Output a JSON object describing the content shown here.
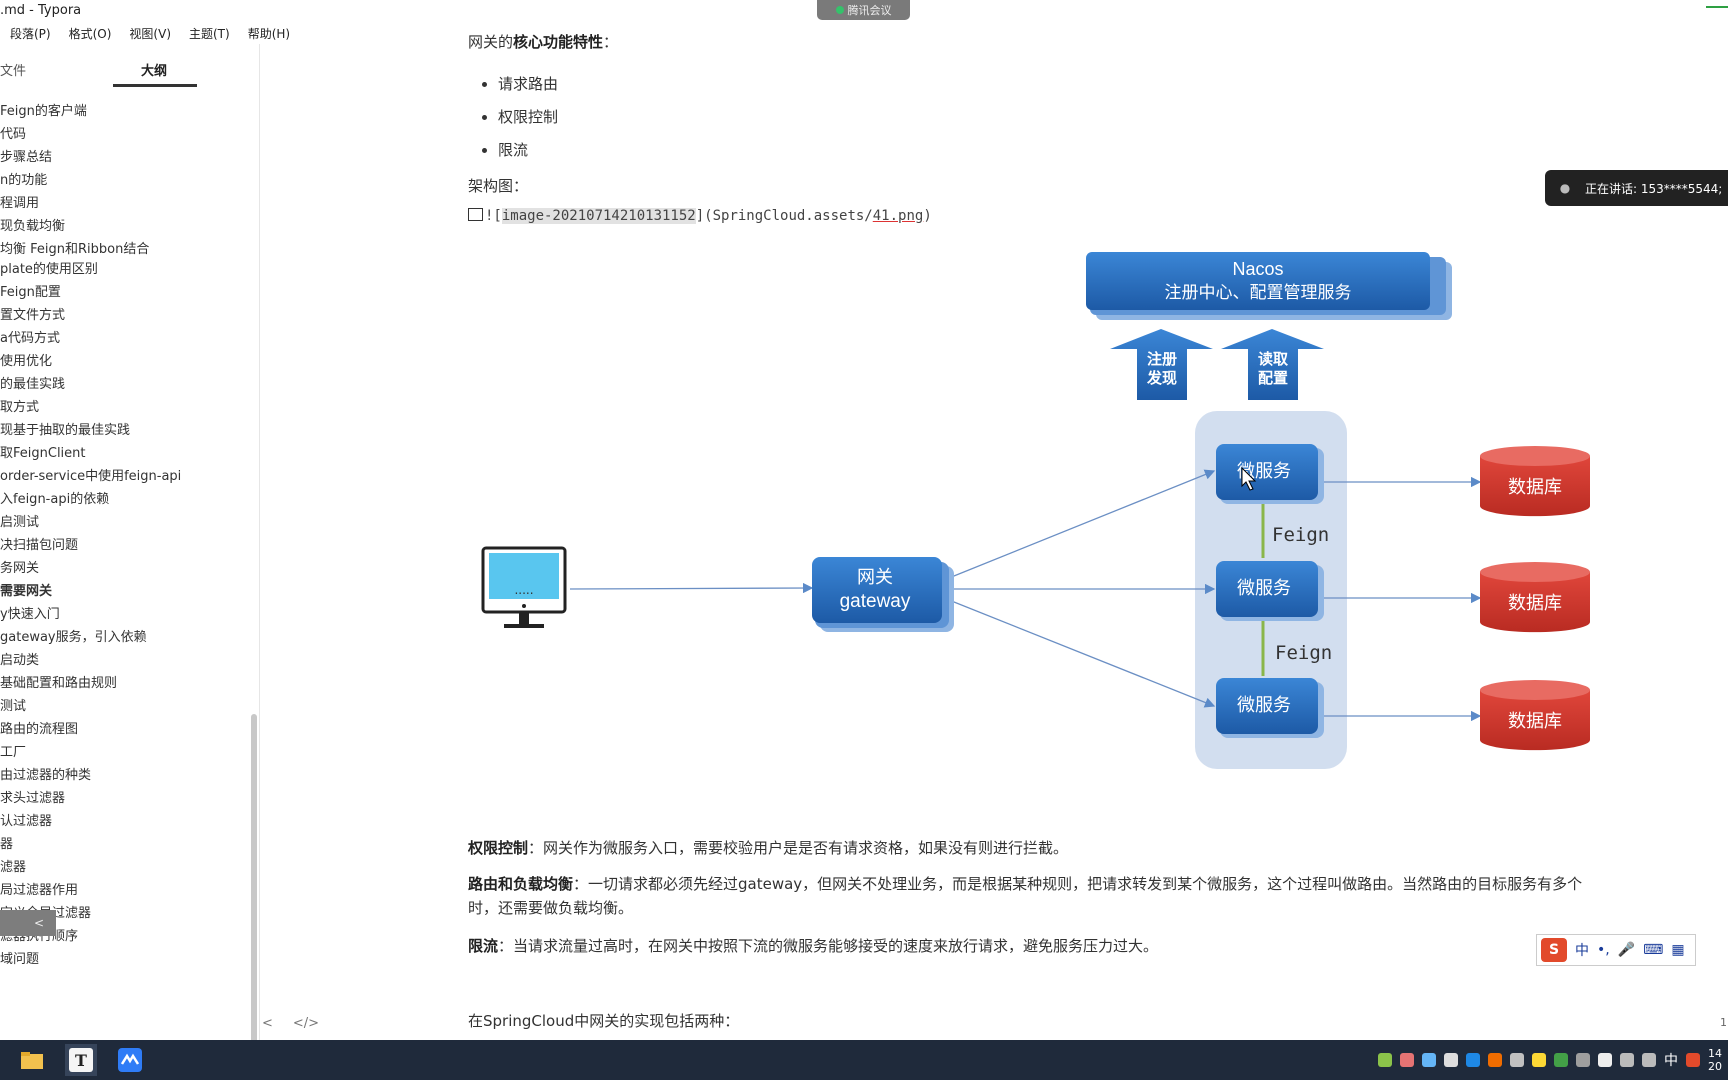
{
  "window": {
    "title": ".md - Typora"
  },
  "meeting": {
    "label": "腾讯会议"
  },
  "menu": [
    "段落(P)",
    "格式(O)",
    "视图(V)",
    "主题(T)",
    "帮助(H)"
  ],
  "sidebar": {
    "tab_files": "文件",
    "tab_outline": "大纲",
    "items": [
      {
        "label": "Feign的客户端"
      },
      {
        "label": "代码"
      },
      {
        "label": "步骤总结"
      },
      {
        "label": "n的功能"
      },
      {
        "label": "程调用"
      },
      {
        "label": "现负载均衡"
      },
      {
        "label": "均衡 Feign和Ribbon结合"
      },
      {
        "label": "plate的使用区别"
      },
      {
        "label": "Feign配置"
      },
      {
        "label": "置文件方式"
      },
      {
        "label": "a代码方式"
      },
      {
        "label": "使用优化"
      },
      {
        "label": "的最佳实践"
      },
      {
        "label": "取方式"
      },
      {
        "label": "现基于抽取的最佳实践"
      },
      {
        "label": "取FeignClient"
      },
      {
        "label": "order-service中使用feign-api"
      },
      {
        "label": "入feign-api的依赖"
      },
      {
        "label": "启测试"
      },
      {
        "label": "决扫描包问题"
      },
      {
        "label": "务网关"
      },
      {
        "label": "需要网关"
      },
      {
        "label": "y快速入门"
      },
      {
        "label": "gateway服务，引入依赖"
      },
      {
        "label": "启动类"
      },
      {
        "label": "基础配置和路由规则"
      },
      {
        "label": "测试"
      },
      {
        "label": "路由的流程图"
      },
      {
        "label": "工厂"
      },
      {
        "label": "由过滤器的种类"
      },
      {
        "label": "求头过滤器"
      },
      {
        "label": "认过滤器"
      },
      {
        "label": "器"
      },
      {
        "label": "滤器"
      },
      {
        "label": "局过滤器作用"
      },
      {
        "label": "定义全局过滤器"
      },
      {
        "label": "滤器执行顺序"
      },
      {
        "label": "域问题"
      }
    ],
    "collapse_label": "<",
    "footer_left": "<",
    "footer_code": "</>"
  },
  "doc": {
    "intro_prefix": "网关的",
    "intro_bold": "核心功能特性",
    "intro_suffix": "：",
    "bullets": [
      "请求路由",
      "权限控制",
      "限流"
    ],
    "arch_label": "架构图：",
    "img_prefix": "![",
    "img_alt": "image-20210714210131152",
    "img_mid": "](SpringCloud.assets/",
    "img_file": "41.png",
    "img_suffix": ")",
    "para1_bold": "权限控制",
    "para1_text": "：网关作为微服务入口，需要校验用户是是否有请求资格，如果没有则进行拦截。",
    "para2_bold": "路由和负载均衡",
    "para2_text": "：一切请求都必须先经过gateway，但网关不处理业务，而是根据某种规则，把请求转发到某个微服务，这个过程叫做路由。当然路由的目标服务有多个时，还需要做负载均衡。",
    "para3_bold": "限流",
    "para3_text": "：当请求流量过高时，在网关中按照下流的微服务能够接受的速度来放行请求，避免服务压力过大。",
    "para4": "在SpringCloud中网关的实现包括两种："
  },
  "diagram": {
    "nacos_title": "Nacos",
    "nacos_subtitle": "注册中心、配置管理服务",
    "arrow1_l1": "注册",
    "arrow1_l2": "发现",
    "arrow2_l1": "读取",
    "arrow2_l2": "配置",
    "gateway_l1": "网关",
    "gateway_l2": "gateway",
    "service": "微服务",
    "feign": "Feign",
    "db": "数据库",
    "monitor_dots": "....."
  },
  "talking": {
    "label": "正在讲话: 153****5544;"
  },
  "ime": {
    "items": [
      "中",
      "•,",
      "🎤",
      "⌨",
      "▦"
    ]
  },
  "tray": {
    "ime_lang": "中",
    "clock_l1": "14",
    "clock_l2": "20"
  },
  "pagenum": "1"
}
